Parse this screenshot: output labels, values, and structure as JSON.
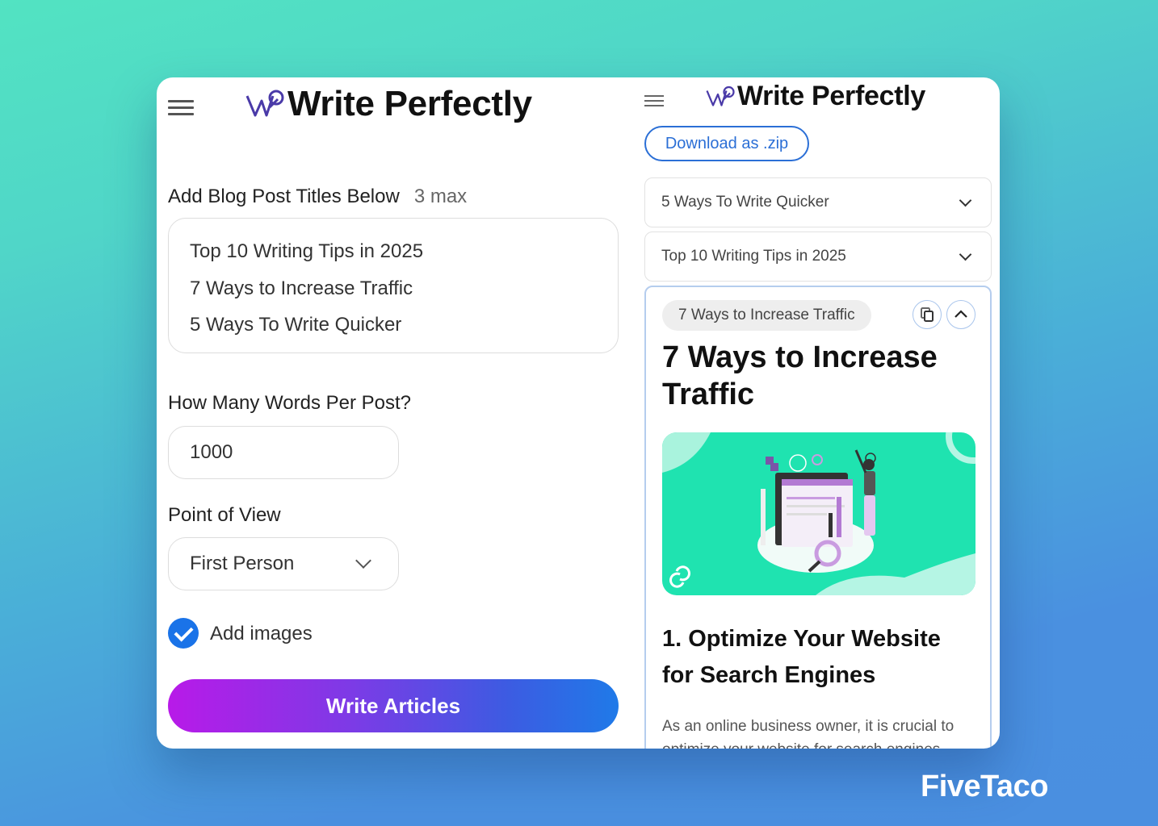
{
  "app": {
    "name": "Write Perfectly"
  },
  "form": {
    "titles_label": "Add Blog Post Titles Below",
    "titles_limit": "3 max",
    "titles": [
      "Top 10 Writing Tips in 2025",
      "7 Ways to Increase Traffic",
      "5 Ways To Write Quicker"
    ],
    "words_label": "How Many Words Per Post?",
    "words_value": "1000",
    "pov_label": "Point of View",
    "pov_value": "First Person",
    "images_label": "Add images",
    "images_checked": true,
    "submit_label": "Write Articles"
  },
  "results": {
    "download_label": "Download as .zip",
    "collapsed": [
      {
        "title": "5 Ways To Write Quicker"
      },
      {
        "title": "Top 10 Writing Tips in 2025"
      }
    ],
    "expanded": {
      "chip": "7 Ways to Increase Traffic",
      "title": "7 Ways to Increase Traffic",
      "section_heading": "1. Optimize Your Website for Search Engines",
      "paragraph": "As an online business owner, it is crucial to optimize your website for search engines."
    }
  },
  "watermark": "FiveTaco",
  "colors": {
    "accent": "#1a73e8",
    "download": "#2b6fd6",
    "hero": "#1fe3b0",
    "gradient_start": "#b81ae8",
    "gradient_end": "#1f7ae8"
  }
}
